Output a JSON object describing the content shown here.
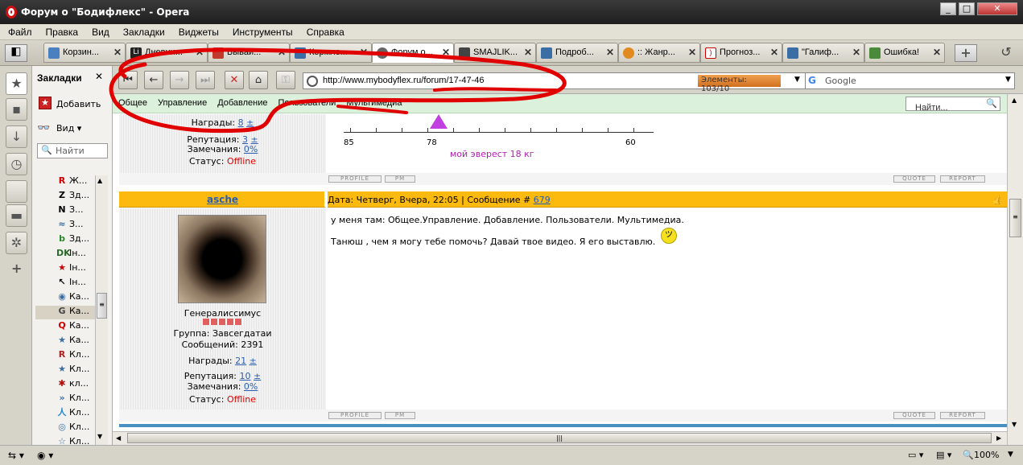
{
  "window": {
    "title": "Форум о \"Бодифлекс\" - Opera"
  },
  "menu": [
    "Файл",
    "Правка",
    "Вид",
    "Закладки",
    "Виджеты",
    "Инструменты",
    "Справка"
  ],
  "tabs": [
    {
      "label": "Корзин...",
      "color": "#4a7fc0"
    },
    {
      "label": "Дневни...",
      "color": "#222"
    },
    {
      "label": "Бывай...",
      "color": "#c0392b"
    },
    {
      "label": "Кормле...",
      "color": "#3a6ea5"
    },
    {
      "label": "Форум о...",
      "color": "#555"
    },
    {
      "label": "SMAJLIK...",
      "color": "#444"
    },
    {
      "label": "Подроб...",
      "color": "#3a6ea5"
    },
    {
      "label": ":: Жанр...",
      "color": "#e08a20"
    },
    {
      "label": "Прогноз...",
      "color": "#c00"
    },
    {
      "label": "\"Галиф...",
      "color": "#3a6ea5"
    },
    {
      "label": "Ошибка!",
      "color": "#4a8a3a"
    }
  ],
  "panel": {
    "title": "Закладки",
    "add": "Добавить",
    "view": "Вид",
    "search_placeholder": "Найти",
    "items": [
      {
        "icon": "R",
        "label": "Ж...",
        "color": "#c00"
      },
      {
        "icon": "Z",
        "label": "Зд...",
        "color": "#000"
      },
      {
        "icon": "N",
        "label": "З...",
        "color": "#000"
      },
      {
        "icon": "≈",
        "label": "З...",
        "color": "#3a6ea5"
      },
      {
        "icon": "b",
        "label": "Зд...",
        "color": "#2a8a2a"
      },
      {
        "icon": "DK",
        "label": "Ін...",
        "color": "#2a6a2a"
      },
      {
        "icon": "★",
        "label": "Ін...",
        "color": "#c00"
      },
      {
        "icon": "↖",
        "label": "Ін...",
        "color": "#000"
      },
      {
        "icon": "◉",
        "label": "Ка...",
        "color": "#3a6ea5"
      },
      {
        "icon": "G",
        "label": "Ка...",
        "color": "#444"
      },
      {
        "icon": "Q",
        "label": "Ка...",
        "color": "#c00"
      },
      {
        "icon": "★",
        "label": "Ка...",
        "color": "#3a6ea5"
      },
      {
        "icon": "R",
        "label": "Кл...",
        "color": "#b02020"
      },
      {
        "icon": "★",
        "label": "Кл...",
        "color": "#3a6ea5"
      },
      {
        "icon": "✱",
        "label": "кл...",
        "color": "#b01010"
      },
      {
        "icon": "»",
        "label": "Кл...",
        "color": "#3a6ea5"
      },
      {
        "icon": "人",
        "label": "Кл...",
        "color": "#2a8ad0"
      },
      {
        "icon": "◎",
        "label": "Кл...",
        "color": "#3a6ea5"
      },
      {
        "icon": "☆",
        "label": "Кл...",
        "color": "#3a6ea5"
      }
    ]
  },
  "address": {
    "url": "http://www.mybodyflex.ru/forum/17-47-46",
    "elements": "Элементы: 103/10",
    "search_placeholder": "Google"
  },
  "forum_nav": [
    "Общее",
    "Управление",
    "Добавление",
    "Пользователи",
    "Мультимедиа"
  ],
  "forum_search_placeholder": "Найти...",
  "post1": {
    "awards_label": "Награды:",
    "awards": "8",
    "plus": "±",
    "rep_label": "Репутация:",
    "rep": "3",
    "warn_label": "Замечания:",
    "warn": "0%",
    "status_label": "Статус:",
    "status": "Offline",
    "ticks": [
      "85",
      "78",
      "60"
    ],
    "ticker_text": "мой эверест 18 кг"
  },
  "buttons": {
    "profile": "PROFILE",
    "pm": "PM",
    "quote": "QUOTE",
    "report": "REPORT"
  },
  "post2": {
    "author": "asche",
    "header_prefix": "Дата: Четверг, Вчера, 22:05 | Сообщение #",
    "msg_num": "679",
    "rank": "Генералиссимус",
    "group": "Группа: Завсегдатаи",
    "messages": "Сообщений: 2391",
    "awards_label": "Награды:",
    "awards": "21",
    "plus": "±",
    "rep_label": "Репутация:",
    "rep": "10",
    "warn_label": "Замечания:",
    "warn": "0%",
    "status_label": "Статус:",
    "status": "Offline",
    "line1": "у меня там: Общее.Управление. Добавление. Пользователи. Мультимедиа.",
    "line2": "Танюш , чем я могу тебе помочь? Давай твое видео. Я его выставлю."
  },
  "statusbar": {
    "zoom": "100%"
  }
}
